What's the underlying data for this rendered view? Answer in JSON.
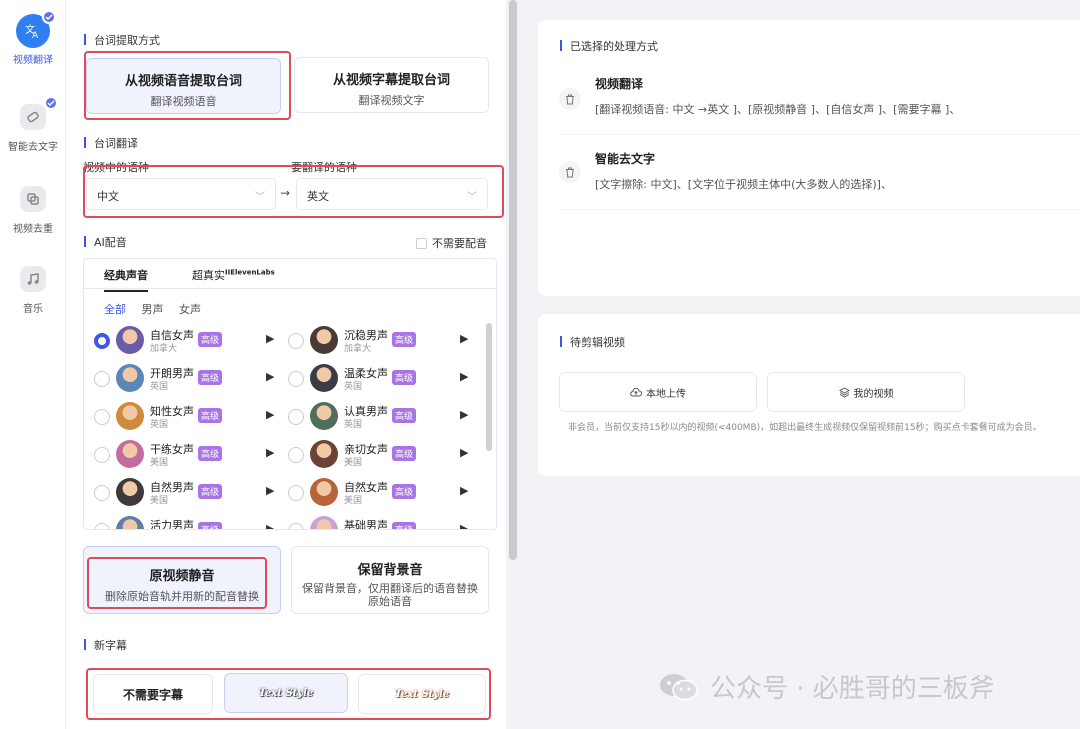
{
  "nav": {
    "items": [
      {
        "label": "视频翻译",
        "icon": "translate-icon",
        "active": true,
        "checked": true
      },
      {
        "label": "智能去文字",
        "icon": "eraser-icon",
        "active": false,
        "checked": true
      },
      {
        "label": "视频去重",
        "icon": "dedupe-icon",
        "active": false,
        "checked": false
      },
      {
        "label": "音乐",
        "icon": "music-icon",
        "active": false,
        "checked": false
      }
    ]
  },
  "extract": {
    "title": "台词提取方式",
    "options": [
      {
        "title": "从视频语音提取台词",
        "sub": "翻译视频语音",
        "selected": true
      },
      {
        "title": "从视频字幕提取台词",
        "sub": "翻译视频文字",
        "selected": false
      }
    ]
  },
  "translate": {
    "title": "台词翻译",
    "source_label": "视频中的语种",
    "target_label": "要翻译的语种",
    "source_value": "中文",
    "target_value": "英文",
    "arrow": "→"
  },
  "dubbing": {
    "title": "AI配音",
    "no_dub_label": "不需要配音",
    "tabs": [
      "经典声音",
      "超真实"
    ],
    "tab_brand": "IIElevenLabs",
    "filters": [
      "全部",
      "男声",
      "女声"
    ],
    "badge": "高级",
    "voices": [
      {
        "name": "自信女声",
        "region": "加拿大",
        "selected": true,
        "color": "#6b5ca8"
      },
      {
        "name": "沉稳男声",
        "region": "加拿大",
        "selected": false,
        "color": "#4a3a36"
      },
      {
        "name": "开朗男声",
        "region": "英国",
        "selected": false,
        "color": "#5a86b8"
      },
      {
        "name": "温柔女声",
        "region": "英国",
        "selected": false,
        "color": "#3c3c48"
      },
      {
        "name": "知性女声",
        "region": "英国",
        "selected": false,
        "color": "#d08a3c"
      },
      {
        "name": "认真男声",
        "region": "英国",
        "selected": false,
        "color": "#4f6f5a"
      },
      {
        "name": "干练女声",
        "region": "美国",
        "selected": false,
        "color": "#c46ca0"
      },
      {
        "name": "亲切女声",
        "region": "美国",
        "selected": false,
        "color": "#6a4236"
      },
      {
        "name": "自然男声",
        "region": "美国",
        "selected": false,
        "color": "#3e3a3a"
      },
      {
        "name": "自然女声",
        "region": "美国",
        "selected": false,
        "color": "#b8643a"
      },
      {
        "name": "活力男声",
        "region": "",
        "selected": false,
        "color": "#5e7ea8"
      },
      {
        "name": "基础男声",
        "region": "",
        "selected": false,
        "color": "#c9a0d8"
      }
    ]
  },
  "audio": {
    "options": [
      {
        "title": "原视频静音",
        "sub": "删除原始音轨并用新的配音替换",
        "selected": true
      },
      {
        "title": "保留背景音",
        "sub": "保留背景音，仅用翻译后的语音替换原始语音",
        "selected": false
      }
    ]
  },
  "subtitle": {
    "title": "新字幕",
    "none_label": "不需要字幕",
    "style_a": "Text Style",
    "style_b": "Text Style"
  },
  "selected_panel": {
    "title": "已选择的处理方式",
    "items": [
      {
        "title": "视频翻译",
        "desc": "[翻译视频语音: 中文 →英文 ]、[原视频静音 ]、[自信女声 ]、[需要字幕 ]、"
      },
      {
        "title": "智能去文字",
        "desc": "[文字擦除: 中文]、[文字位于视频主体中(大多数人的选择)]、"
      }
    ]
  },
  "pending": {
    "title": "待剪辑视频",
    "upload_label": "本地上传",
    "my_video_label": "我的视频",
    "note": "非会员，当前仅支持15秒以内的视频(<400MB)，如超出最终生成视频仅保留视频前15秒；购买点卡套餐可成为会员。"
  },
  "watermark": {
    "text": "公众号 · 必胜哥的三板斧"
  },
  "colors": {
    "accent": "#3b56e8",
    "badge": "#a874e6",
    "highlight": "#e04b5c"
  }
}
